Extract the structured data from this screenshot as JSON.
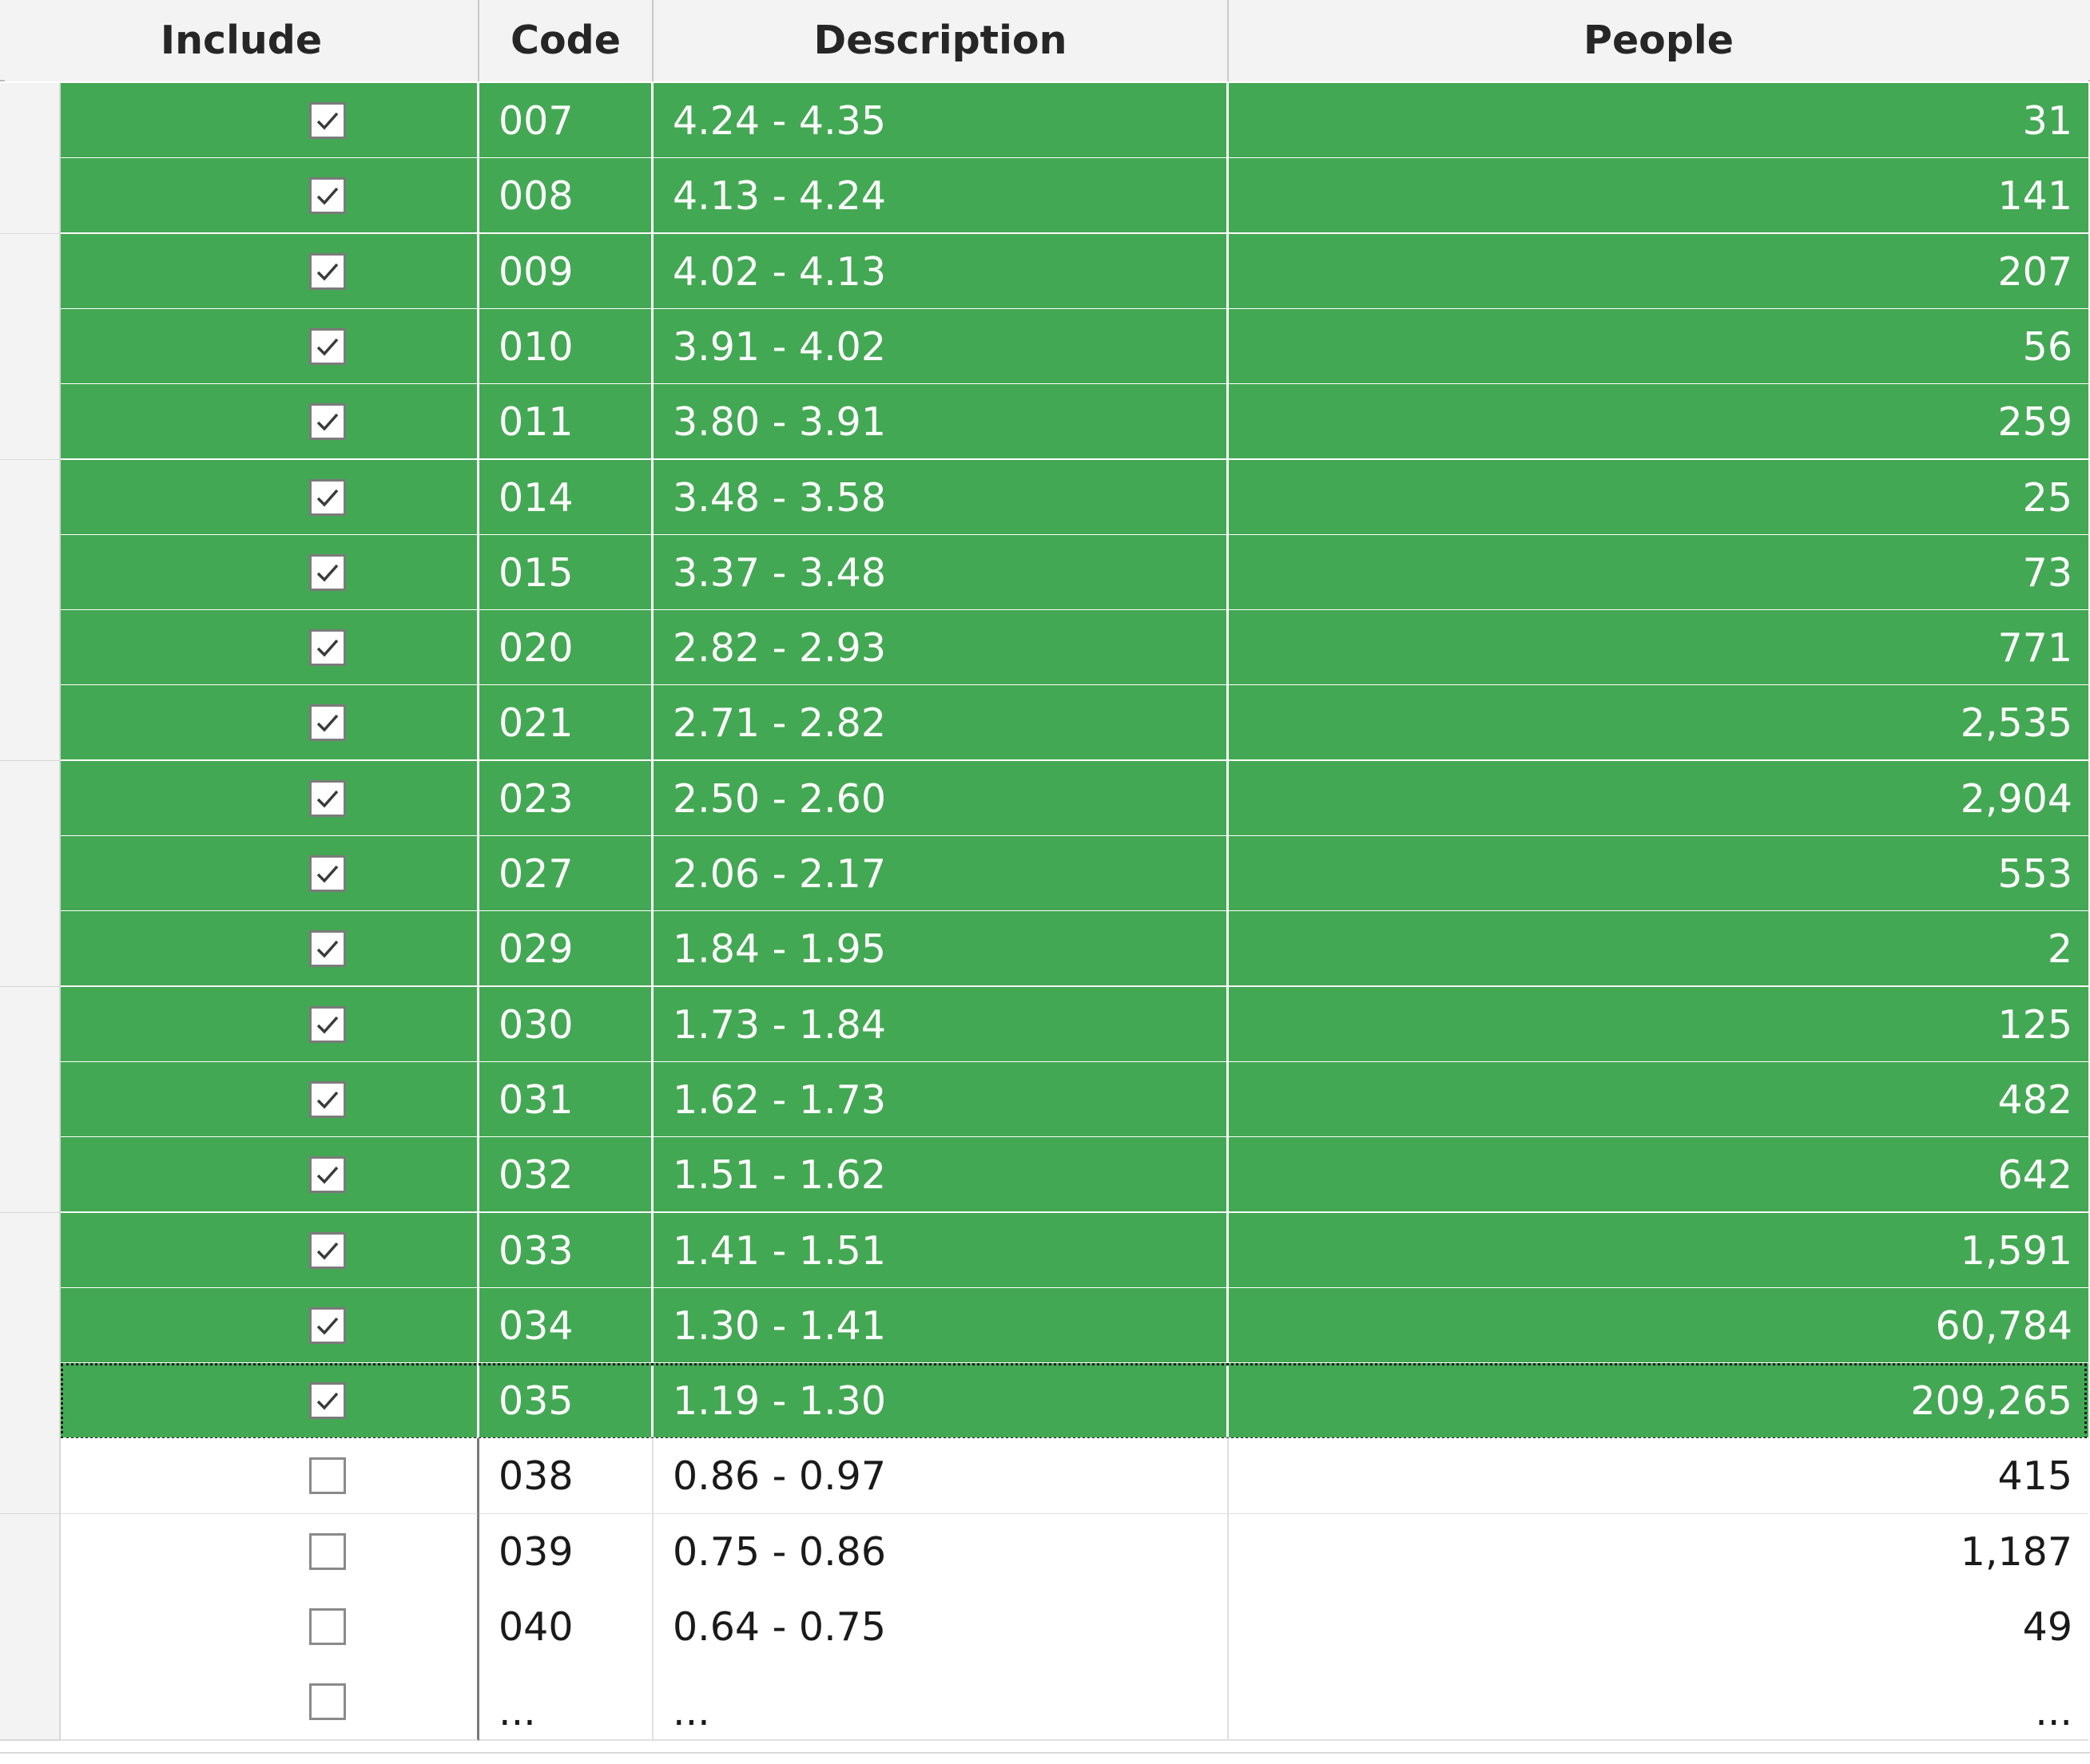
{
  "columns": {
    "include": "Include",
    "code": "Code",
    "description": "Description",
    "people": "People"
  },
  "colors": {
    "included_row": "#43a853",
    "header_bg": "#f3f3f3"
  },
  "checkbox_icon": "checkmark-icon",
  "rows": [
    {
      "include": true,
      "code": "007",
      "description": "4.24 - 4.35",
      "people": "31"
    },
    {
      "include": true,
      "code": "008",
      "description": "4.13 - 4.24",
      "people": "141"
    },
    {
      "include": true,
      "code": "009",
      "description": "4.02 - 4.13",
      "people": "207"
    },
    {
      "include": true,
      "code": "010",
      "description": "3.91 - 4.02",
      "people": "56"
    },
    {
      "include": true,
      "code": "011",
      "description": "3.80 - 3.91",
      "people": "259"
    },
    {
      "include": true,
      "code": "014",
      "description": "3.48 - 3.58",
      "people": "25"
    },
    {
      "include": true,
      "code": "015",
      "description": "3.37 - 3.48",
      "people": "73"
    },
    {
      "include": true,
      "code": "020",
      "description": "2.82 - 2.93",
      "people": "771"
    },
    {
      "include": true,
      "code": "021",
      "description": "2.71 - 2.82",
      "people": "2,535"
    },
    {
      "include": true,
      "code": "023",
      "description": "2.50 - 2.60",
      "people": "2,904"
    },
    {
      "include": true,
      "code": "027",
      "description": "2.06 - 2.17",
      "people": "553"
    },
    {
      "include": true,
      "code": "029",
      "description": "1.84 - 1.95",
      "people": "2"
    },
    {
      "include": true,
      "code": "030",
      "description": "1.73 - 1.84",
      "people": "125"
    },
    {
      "include": true,
      "code": "031",
      "description": "1.62 - 1.73",
      "people": "482"
    },
    {
      "include": true,
      "code": "032",
      "description": "1.51 - 1.62",
      "people": "642"
    },
    {
      "include": true,
      "code": "033",
      "description": "1.41 - 1.51",
      "people": "1,591"
    },
    {
      "include": true,
      "code": "034",
      "description": "1.30 - 1.41",
      "people": "60,784"
    },
    {
      "include": true,
      "code": "035",
      "description": "1.19 - 1.30",
      "people": "209,265",
      "current": true
    },
    {
      "include": false,
      "code": "038",
      "description": "0.86 - 0.97",
      "people": "415"
    },
    {
      "include": false,
      "code": "039",
      "description": "0.75 - 0.86",
      "people": "1,187"
    },
    {
      "include": false,
      "code": "040",
      "description": "0.64 - 0.75",
      "people": "49"
    },
    {
      "include": false,
      "code": "...",
      "description": "...",
      "people": "..."
    }
  ]
}
